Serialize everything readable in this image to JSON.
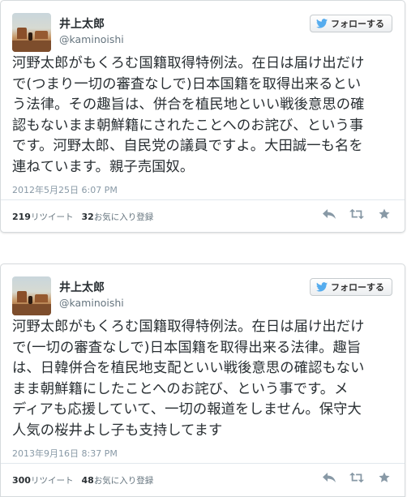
{
  "tweets": [
    {
      "name": "井上太郎",
      "handle": "@kaminoishi",
      "follow_label": "フォローする",
      "lines": [
        "河野太郎がもくろむ国籍取得特例法。在日は届け出だけ",
        "で(つまり一切の審査なしで)日本国籍を取得出来るとい",
        "う法律。その趣旨は、併合を植民地といい戦後意思の確",
        "認もないまま朝鮮籍にされたことへのお詫び、という事",
        "です。河野太郎、自民党の議員ですよ。大田誠一も名を",
        "連ねています。親子売国奴。"
      ],
      "timestamp": "2012年5月25日 6:07 PM",
      "retweets_count": "219",
      "retweets_label": "リツイート",
      "favorites_count": "32",
      "favorites_label": "お気に入り登録"
    },
    {
      "name": "井上太郎",
      "handle": "@kaminoishi",
      "follow_label": "フォローする",
      "lines": [
        "河野太郎がもくろむ国籍取得特例法。在日は届け出だけ",
        "で(一切の審査なしで)日本国籍を取得出来る法律。趣旨",
        "は、日韓併合を植民地支配といい戦後意思の確認もない",
        "まま朝鮮籍にしたことへのお詫び、という事です。メ",
        "ディアも応援していて、一切の報道をしません。保守大",
        "人気の桜井よし子も支持してます"
      ],
      "timestamp": "2013年9月16日 8:37 PM",
      "retweets_count": "300",
      "retweets_label": "リツイート",
      "favorites_count": "48",
      "favorites_label": "お気に入り登録"
    }
  ],
  "icons": {
    "bird": "twitter-bird-icon",
    "reply": "reply-icon",
    "retweet": "retweet-icon",
    "favorite": "star-icon"
  },
  "colors": {
    "bird": "#55acee",
    "action_icons": "#8899a6",
    "border": "#d6dadd"
  }
}
